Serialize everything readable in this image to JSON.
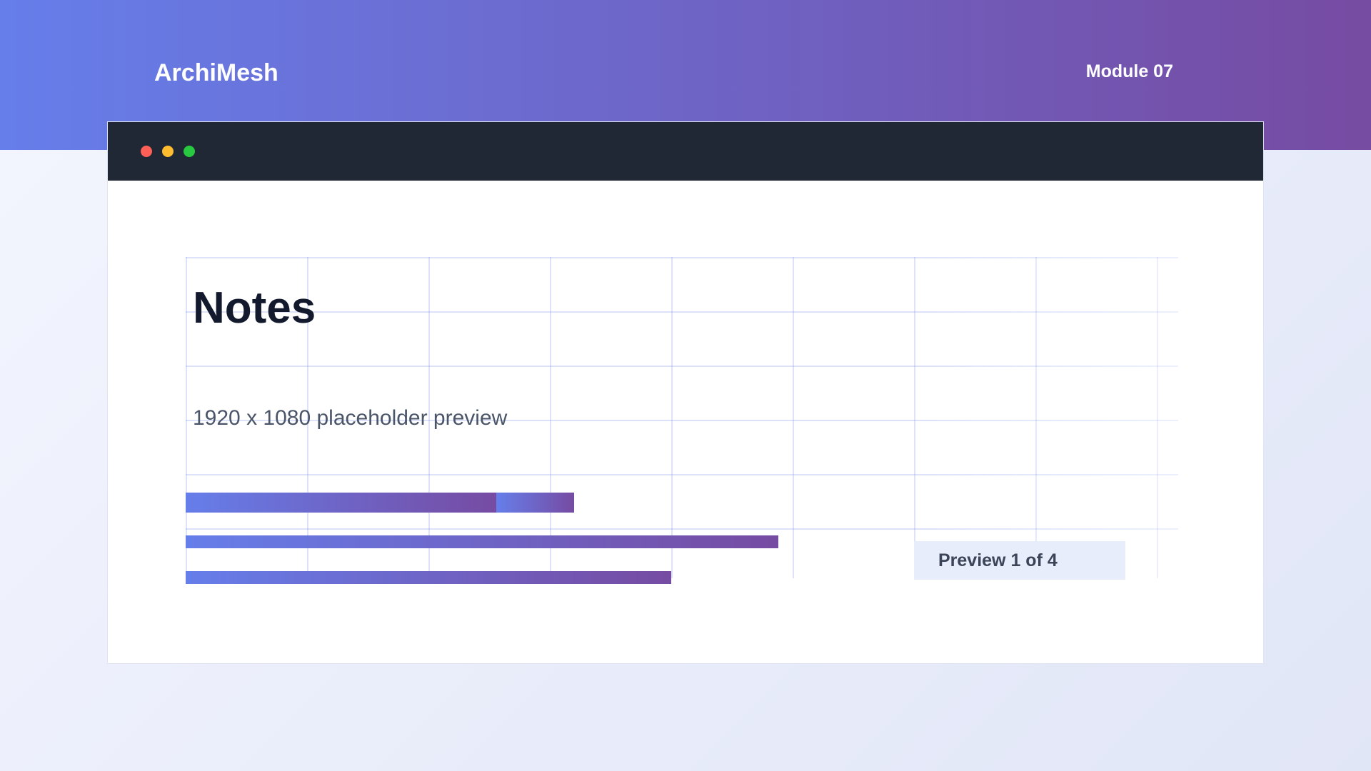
{
  "header": {
    "brand": "ArchiMesh",
    "module": "Module 07"
  },
  "window": {
    "controls": [
      "close",
      "minimize",
      "maximize"
    ]
  },
  "content": {
    "title": "Notes",
    "subtitle": "1920 x 1080 placeholder preview",
    "progress_bars": [
      {
        "name": "bar-1",
        "fraction": 0.4
      },
      {
        "name": "bar-2",
        "fraction": 0.61
      },
      {
        "name": "bar-3",
        "fraction": 0.5
      }
    ],
    "badge": "Preview 1 of 4"
  },
  "colors": {
    "gradient_start": "#667eea",
    "gradient_end": "#764ba2",
    "titlebar": "#202836",
    "close": "#fe5f57",
    "minimize": "#febc2e",
    "maximize": "#28c840"
  }
}
